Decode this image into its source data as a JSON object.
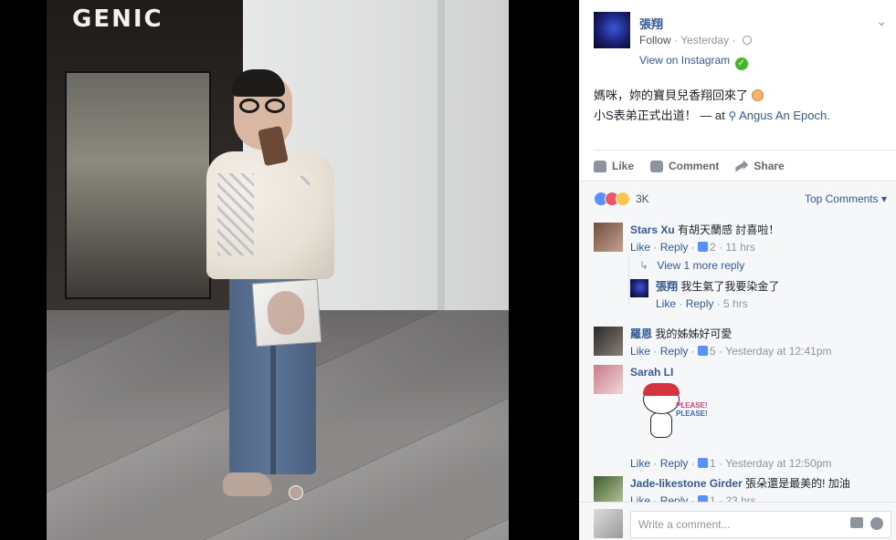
{
  "photo": {
    "storefront_sign": "GENIC"
  },
  "post": {
    "author": "張翔",
    "follow": "Follow",
    "time": "Yesterday",
    "instagram": "View on Instagram",
    "text_line1": "媽咪，妳的寶貝兒香翔回來了",
    "text_line2": "小S表弟正式出道！",
    "at_prefix": "— at",
    "location": "Angus An Epoch."
  },
  "actions": {
    "like": "Like",
    "comment": "Comment",
    "share": "Share"
  },
  "stats": {
    "reactions_count": "3K",
    "top_comments": "Top Comments"
  },
  "comments": [
    {
      "name": "Stars Xu",
      "text": "有胡天蘭感 討喜啦！",
      "like": "Like",
      "reply": "Reply",
      "likes": "2",
      "time": "11 hrs"
    },
    {
      "view_more": "View 1 more reply"
    },
    {
      "name": "張翔",
      "text": "我生氣了我要染金了",
      "like": "Like",
      "reply": "Reply",
      "time": "5 hrs"
    },
    {
      "name": "羅恩",
      "text": "我的姊姊好可愛",
      "like": "Like",
      "reply": "Reply",
      "likes": "5",
      "time": "Yesterday at 12:41pm"
    },
    {
      "name": "Sarah LI",
      "sticker_text_1": "PLEASE!",
      "sticker_text_2": "PLEASE!",
      "like": "Like",
      "reply": "Reply",
      "likes": "1",
      "time": "Yesterday at 12:50pm"
    },
    {
      "name": "Jade-likestone Girder",
      "text": "張朵還是最美的! 加油",
      "like": "Like",
      "reply": "Reply",
      "likes": "1",
      "time": "23 hrs"
    }
  ],
  "composer": {
    "placeholder": "Write a comment..."
  }
}
